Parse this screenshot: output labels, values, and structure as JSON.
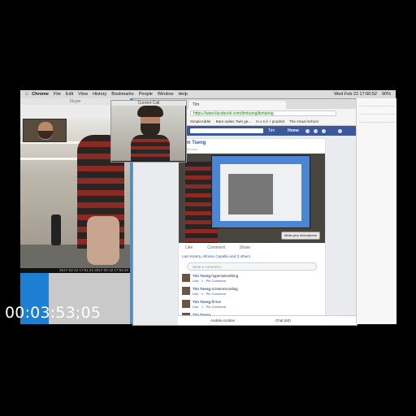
{
  "menubar": {
    "apple": "",
    "items": [
      "Chrome",
      "File",
      "Edit",
      "View",
      "History",
      "Bookmarks",
      "People",
      "Window",
      "Help"
    ],
    "clock": "Wed Feb 22  17:60:52",
    "battery": "90%"
  },
  "left_window": {
    "title": "Skype",
    "timestamps": "2017-02-22 17:51:43  2017-02-22 17:52:20"
  },
  "call_window": {
    "title": "Current Call"
  },
  "browser": {
    "tab_title": "Tim",
    "url": "https://www.facebook.com/timtsang/timtseng",
    "bookmarks": [
      "SimpleAdder",
      "Bare Aplies Twin ge...",
      "m o n k + prophet",
      "The Artual School"
    ],
    "fb_user": "Tim",
    "fb_home": "Home",
    "post_author": "Tim Tseng",
    "post_sub": "is live now.",
    "mute_label": "Mute your microphone",
    "actions": [
      "Like",
      "Comment",
      "Share"
    ],
    "likes_text": "Lars Kearry, Alfonso Capellio and 3 others",
    "comment_placeholder": "Write a comment...",
    "comments": [
      {
        "author": "Tim Tseng",
        "text": "hyperselectthing",
        "meta": "Like · 1 · Pin Comment"
      },
      {
        "author": "Tim Tseng",
        "text": "screenrecording",
        "meta": "Like · 1 · Pin Comment"
      },
      {
        "author": "Tim Tseng",
        "text": "fb live",
        "meta": "Like · 1 · Pin Comment"
      },
      {
        "author": "Tim Tseng",
        "text": "",
        "meta": ""
      }
    ],
    "chat_left": "Andrés Azoline",
    "chat_label": "Chat (60)"
  },
  "timecode": "00:03:53;05"
}
